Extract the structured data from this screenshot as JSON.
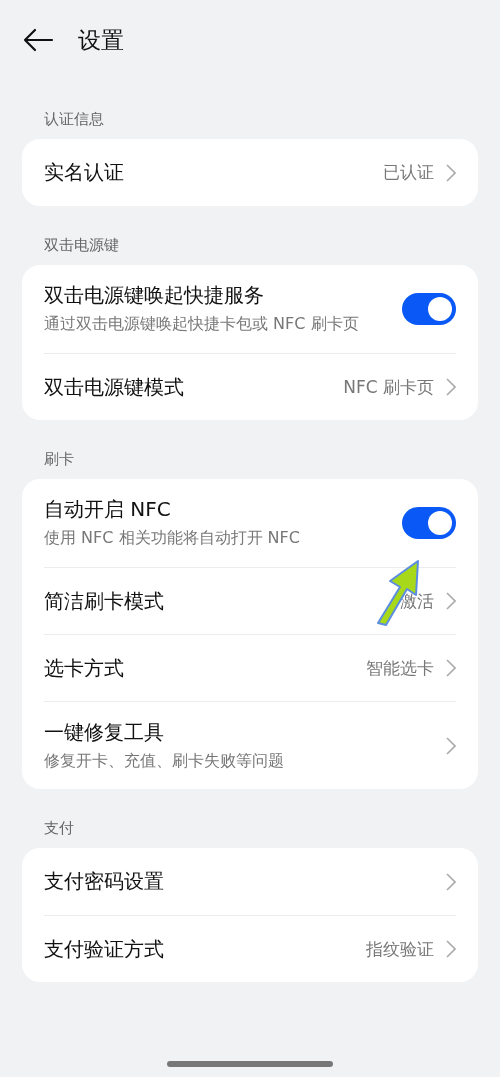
{
  "header": {
    "title": "设置"
  },
  "sections": [
    {
      "label": "认证信息",
      "items": [
        {
          "kind": "link",
          "title": "实名认证",
          "value": "已认证"
        }
      ]
    },
    {
      "label": "双击电源键",
      "items": [
        {
          "kind": "toggle",
          "title": "双击电源键唤起快捷服务",
          "desc": "通过双击电源键唤起快捷卡包或 NFC 刷卡页",
          "on": true
        },
        {
          "kind": "link",
          "title": "双击电源键模式",
          "value": "NFC 刷卡页"
        }
      ]
    },
    {
      "label": "刷卡",
      "items": [
        {
          "kind": "toggle",
          "title": "自动开启 NFC",
          "desc": "使用 NFC 相关功能将自动打开 NFC",
          "on": true
        },
        {
          "kind": "link",
          "title": "简洁刷卡模式",
          "value": "激活"
        },
        {
          "kind": "link",
          "title": "选卡方式",
          "value": "智能选卡"
        },
        {
          "kind": "link",
          "title": "一键修复工具",
          "desc": "修复开卡、充值、刷卡失败等问题"
        }
      ]
    },
    {
      "label": "支付",
      "items": [
        {
          "kind": "link",
          "title": "支付密码设置"
        },
        {
          "kind": "link",
          "title": "支付验证方式",
          "value": "指纹验证"
        }
      ]
    }
  ]
}
